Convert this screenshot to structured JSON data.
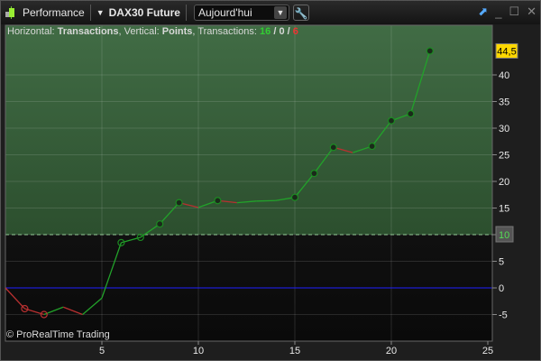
{
  "titlebar": {
    "app_label": "Performance",
    "instrument": "DAX30 Future",
    "period": "Aujourd'hui",
    "icons": [
      "candlestick-icon",
      "dropdown-arrow-icon",
      "wrench-icon",
      "export-chart-icon",
      "minimize-icon",
      "maximize-icon",
      "close-icon"
    ]
  },
  "info": {
    "h_label": "Horizontal: ",
    "h_value": "Transactions",
    "v_label": ", Vertical: ",
    "v_value": "Points",
    "t_label": ", Transactions: ",
    "wins": "16",
    "sep1": " / ",
    "neutral": "0",
    "sep2": " / ",
    "losses": "6"
  },
  "copyright": "© ProRealTime Trading",
  "colors": {
    "win": "#22a22a",
    "loss": "#b83030",
    "zero_line": "#2020ff",
    "zone": "#3a6a3e",
    "last_value_bg": "#ffd800"
  },
  "chart_data": {
    "type": "line",
    "x": [
      0,
      1,
      2,
      3,
      4,
      5,
      6,
      7,
      8,
      9,
      10,
      11,
      12,
      13,
      14,
      15,
      16,
      17,
      18,
      19,
      20,
      21,
      22
    ],
    "y": [
      0,
      -3.9,
      -5,
      -3.6,
      -5,
      -1.9,
      8.5,
      9.5,
      12,
      16,
      15.1,
      16.4,
      16,
      16.3,
      16.4,
      17,
      21.5,
      26.4,
      25.4,
      26.6,
      31.4,
      32.7,
      44.5
    ],
    "markers": [
      1,
      2,
      6,
      7,
      8,
      9,
      11,
      15,
      16,
      17,
      19,
      20,
      21,
      22
    ],
    "xlim": [
      0,
      25
    ],
    "ylim": [
      -10,
      47.5
    ],
    "x_ticks": [
      "5",
      "10",
      "15",
      "20",
      "25"
    ],
    "y_ticks": [
      "-5",
      "0",
      "5",
      "10",
      "15",
      "20",
      "25",
      "30",
      "35",
      "40"
    ],
    "threshold": 10,
    "threshold_label": "10",
    "last_value_label": "44,5",
    "grid": true
  }
}
